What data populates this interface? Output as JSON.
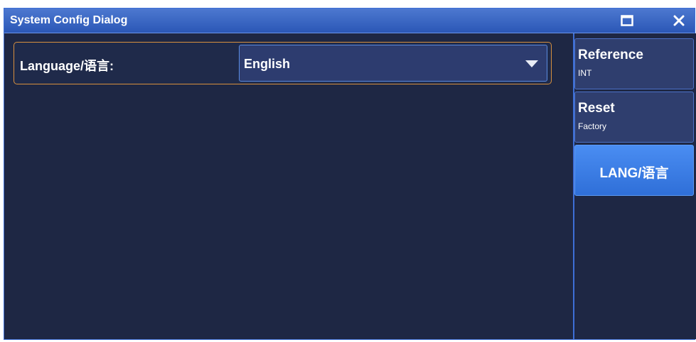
{
  "window": {
    "title": "System Config Dialog"
  },
  "title_buttons": {
    "maximize_icon": "maximize-icon",
    "close_icon": "close-icon"
  },
  "language_setting": {
    "label": "Language/语言:",
    "selected_value": "English"
  },
  "side_menu": {
    "items": [
      {
        "label": "Reference",
        "sublabel": "INT",
        "active": false
      },
      {
        "label": "Reset",
        "sublabel": "Factory",
        "active": false
      },
      {
        "label": "LANG/语言",
        "sublabel": "",
        "active": true
      }
    ]
  },
  "colors": {
    "background": "#1e2744",
    "titlebar": "#2b57b6",
    "accent_border": "#d8903e",
    "active_button": "#3d7fe6"
  }
}
